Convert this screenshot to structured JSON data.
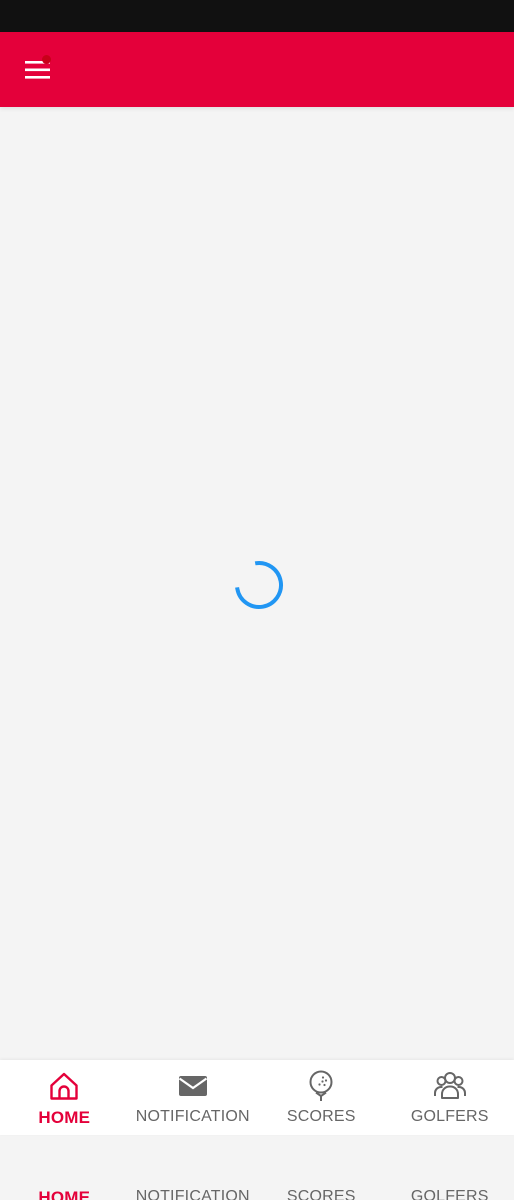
{
  "colors": {
    "brand_red": "#e4003a",
    "spinner_blue": "#2196f3",
    "inactive_gray": "#666666",
    "background": "#f4f4f4"
  },
  "header": {
    "menu_icon": "hamburger-menu-icon",
    "has_notification_dot": true
  },
  "content": {
    "state": "loading"
  },
  "bottom_nav": {
    "active_index": 0,
    "items": [
      {
        "label": "HOME",
        "icon": "home-icon"
      },
      {
        "label": "NOTIFICATION",
        "icon": "mail-icon"
      },
      {
        "label": "SCORES",
        "icon": "golf-ball-icon"
      },
      {
        "label": "GOLFERS",
        "icon": "group-icon"
      }
    ]
  }
}
